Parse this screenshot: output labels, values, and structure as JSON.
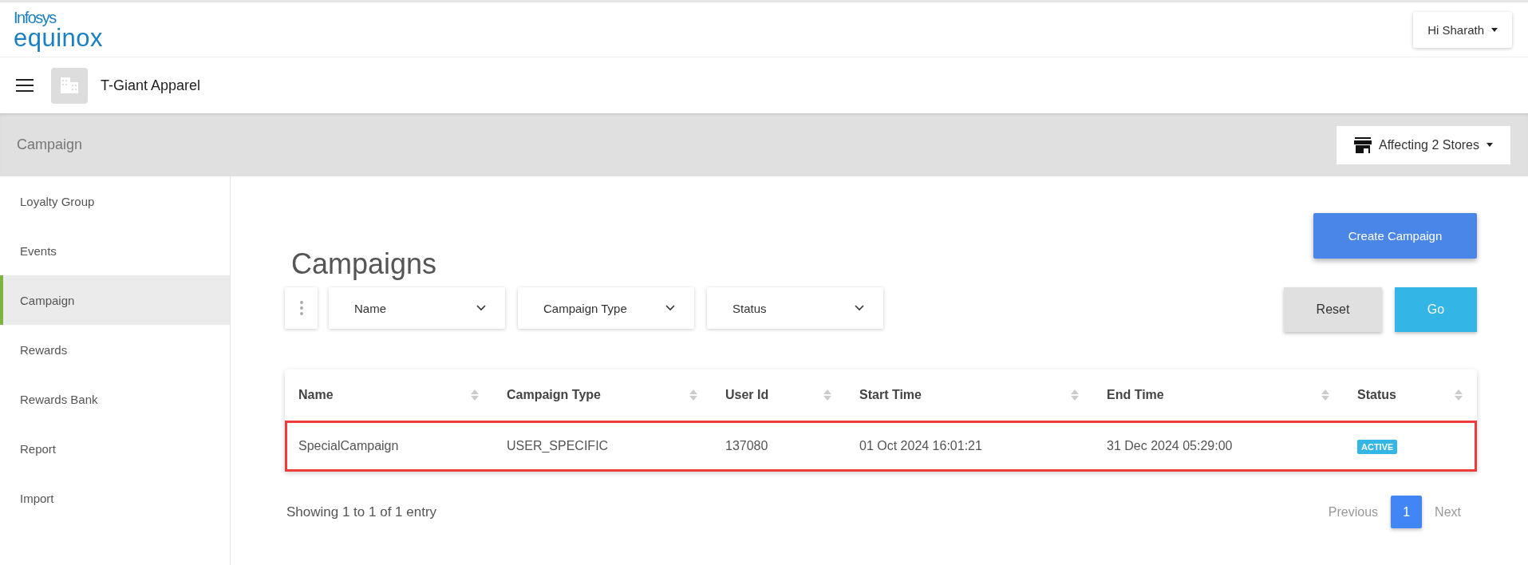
{
  "header": {
    "logo_top": "Infosys",
    "logo_bottom": "equinox",
    "user_menu": "Hi Sharath"
  },
  "org_bar": {
    "org_name": "T-Giant Apparel"
  },
  "page_bar": {
    "title": "Campaign",
    "stores_button": "Affecting 2 Stores"
  },
  "sidebar": {
    "items": [
      {
        "label": "Loyalty Group",
        "selected": false
      },
      {
        "label": "Events",
        "selected": false
      },
      {
        "label": "Campaign",
        "selected": true
      },
      {
        "label": "Rewards",
        "selected": false
      },
      {
        "label": "Rewards Bank",
        "selected": false
      },
      {
        "label": "Report",
        "selected": false
      },
      {
        "label": "Import",
        "selected": false
      }
    ]
  },
  "main": {
    "title": "Campaigns",
    "create_button": "Create Campaign",
    "filters": [
      {
        "label": "Name"
      },
      {
        "label": "Campaign Type"
      },
      {
        "label": "Status"
      }
    ],
    "reset_button": "Reset",
    "go_button": "Go",
    "table": {
      "columns": [
        "Name",
        "Campaign Type",
        "User Id",
        "Start Time",
        "End Time",
        "Status"
      ],
      "rows": [
        {
          "selected": true,
          "name": "SpecialCampaign",
          "campaign_type": "USER_SPECIFIC",
          "user_id": "137080",
          "start_time": "01 Oct 2024 16:01:21",
          "end_time": "31 Dec 2024 05:29:00",
          "status": "ACTIVE"
        }
      ]
    },
    "summary": "Showing 1 to 1 of 1 entry",
    "pagination": {
      "previous": "Previous",
      "next": "Next",
      "pages": [
        {
          "label": "1",
          "selected": true
        }
      ]
    }
  }
}
